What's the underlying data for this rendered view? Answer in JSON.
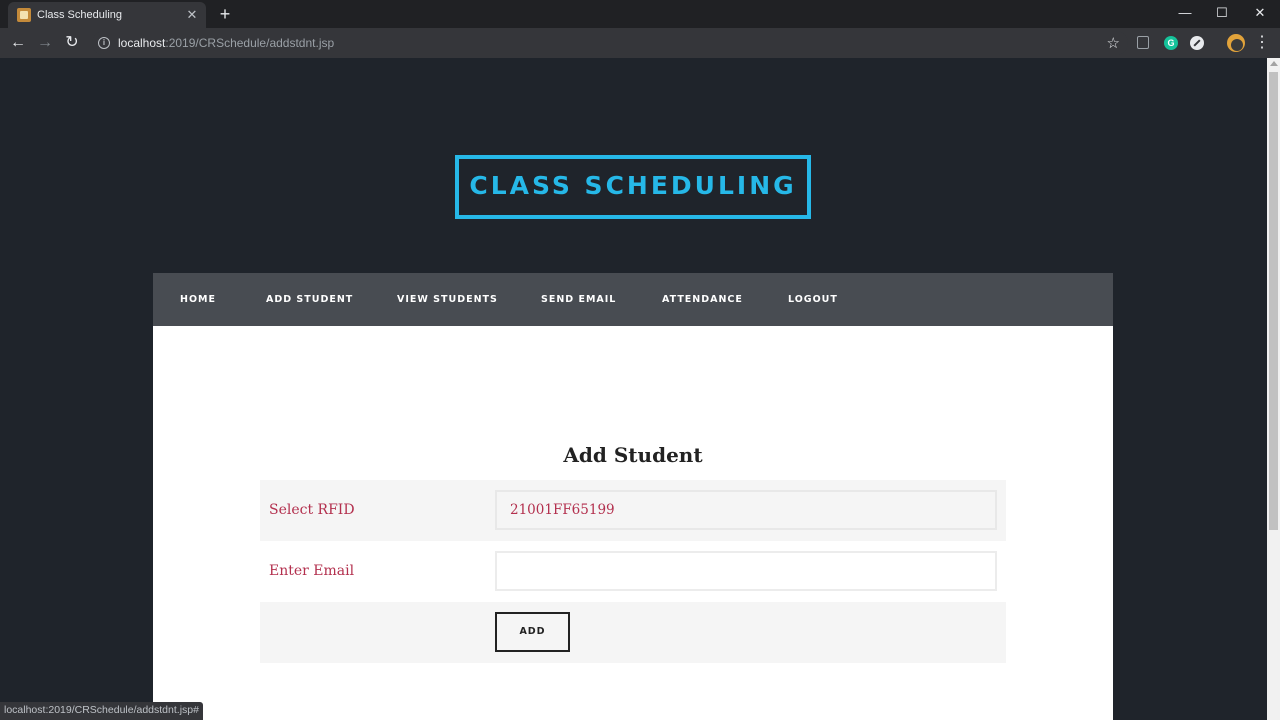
{
  "browser": {
    "tab_title": "Class Scheduling",
    "tab_close": "✕",
    "new_tab": "+",
    "url_host": "localhost",
    "url_path": ":2019/CRSchedule/addstdnt.jsp",
    "window_controls": {
      "minimize": "—",
      "maximize": "☐",
      "close": "✕"
    },
    "nav": {
      "back": "←",
      "forward": "→",
      "reload": "↻"
    },
    "star": "☆",
    "menu": "⋮",
    "extension_grammarly": "G",
    "status_url": "localhost:2019/CRSchedule/addstdnt.jsp#"
  },
  "site": {
    "logo": "CLASS SCHEDULING",
    "nav_items": [
      "HOME",
      "ADD STUDENT",
      "VIEW STUDENTS",
      "SEND EMAIL",
      "ATTENDANCE",
      "LOGOUT"
    ]
  },
  "form": {
    "title": "Add Student",
    "rfid_label": "Select RFID",
    "rfid_value": "21001FF65199",
    "email_label": "Enter Email",
    "email_value": "",
    "email_placeholder": "",
    "submit_label": "ADD"
  },
  "colors": {
    "accent": "#26b8e8",
    "page_background": "#1f242b",
    "nav_background": "#484c52",
    "label_color": "#b3304e"
  }
}
